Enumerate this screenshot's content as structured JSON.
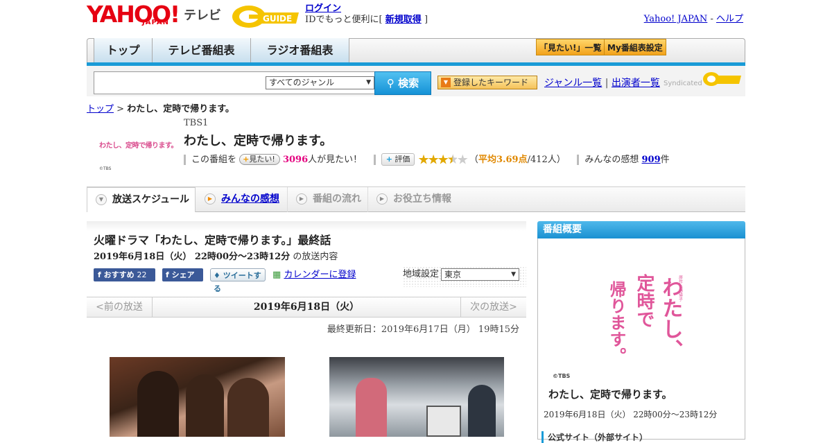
{
  "header": {
    "logo_yahoo": "YAHOO!",
    "logo_japan": "JAPAN",
    "logo_tv": "テレビ",
    "login_label": "ログイン",
    "signup_prefix": "IDでもっと便利に[",
    "signup_link": "新規取得",
    "signup_suffix": "]",
    "yahoo_japan_link": "Yahoo! JAPAN",
    "separator": "-",
    "help_link": "ヘルプ"
  },
  "nav": {
    "tabs": [
      {
        "label": "トップ"
      },
      {
        "label": "テレビ番組表"
      },
      {
        "label": "ラジオ番組表"
      }
    ],
    "mitai_list": "「見たい!」一覧",
    "my_schedule": "My番組表設定"
  },
  "search": {
    "input_value": "",
    "genre_selected": "すべてのジャンル",
    "search_button": "検索",
    "keyword_button": "登録したキーワード",
    "genre_link": "ジャンル一覧",
    "divider": "|",
    "performer_link": "出演者一覧",
    "syndicated": "Syndicated"
  },
  "breadcrumb": {
    "top": "トップ",
    "sep": ">",
    "current": "わたし、定時で帰ります。"
  },
  "show": {
    "thumb_title": "わたし、定時で帰ります。",
    "thumb_copyright": "©TBS",
    "station": "TBS1",
    "title": "わたし、定時で帰ります。",
    "want_prefix": "この番組を",
    "want_button": "見たい!",
    "want_count": "3096",
    "want_suffix": "人が見たい！",
    "rate_button": "評価",
    "rating_open": "（",
    "rating_avg": "平均3.69点",
    "rating_count": "/412人）",
    "rating_value": 3.69,
    "reviews_prefix": "みんなの感想",
    "reviews_count": "909",
    "reviews_suffix": "件"
  },
  "subtabs": [
    {
      "label": "放送スケジュール"
    },
    {
      "label": "みんなの感想"
    },
    {
      "label": "番組の流れ"
    },
    {
      "label": "お役立ち情報"
    }
  ],
  "episode": {
    "title": "火曜ドラマ「わたし、定時で帰ります。」最終話",
    "date": "2019年6月18日（火）  22時00分～23時12分",
    "date_suffix": "の放送内容",
    "fb_recommend": "おすすめ",
    "fb_count": "22",
    "fb_share": "シェア",
    "tweet": "ツイートする",
    "calendar": "カレンダーに登録",
    "region_label": "地域設定",
    "region_selected": "東京",
    "prev": "<前の放送",
    "current": "2019年6月18日（火）",
    "next": "次の放送>",
    "updated": "最終更新日：2019年6月17日（月）  19時15分"
  },
  "sidebar": {
    "header": "番組概要",
    "poster_text": "わたし、定時で帰ります。",
    "poster_small": "原作 朱野帰子",
    "copyright": "©TBS",
    "title": "わたし、定時で帰ります。",
    "date": "2019年6月18日（火）  22時00分～23時12分",
    "official": "公式サイト（外部サイト）"
  },
  "colors": {
    "accent_blue": "#1a9bd7",
    "yahoo_red": "#e60012",
    "pink": "#e4007f",
    "orange": "#e08800"
  }
}
